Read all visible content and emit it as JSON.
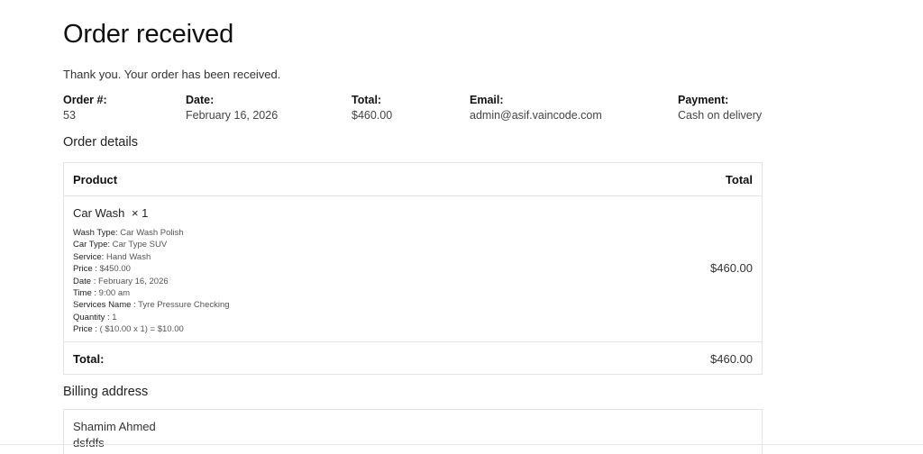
{
  "page": {
    "title": "Order received",
    "thank_you": "Thank you. Your order has been received."
  },
  "overview": {
    "order_number_label": "Order #:",
    "order_number": "53",
    "date_label": "Date:",
    "date": "February 16, 2026",
    "total_label": "Total:",
    "total": "$460.00",
    "email_label": "Email:",
    "email": "admin@asif.vaincode.com",
    "payment_label": "Payment:",
    "payment": "Cash on delivery"
  },
  "order_details": {
    "heading": "Order details",
    "columns": {
      "product": "Product",
      "total": "Total"
    },
    "items": [
      {
        "name": "Car Wash",
        "quantity": "× 1",
        "line_total": "$460.00",
        "meta": [
          {
            "key": "Wash Type:",
            "value": " Car Wash Polish"
          },
          {
            "key": "Car Type:",
            "value": " Car Type SUV"
          },
          {
            "key": "Service:",
            "value": " Hand Wash"
          },
          {
            "key": "Price :",
            "value": " $450.00"
          },
          {
            "key": "Date :",
            "value": " February 16, 2026"
          },
          {
            "key": "Time :",
            "value": " 9:00 am"
          },
          {
            "key": "Services Name :",
            "value": " Tyre Pressure Checking"
          },
          {
            "key": "Quantity :",
            "value": " 1"
          },
          {
            "key": "Price :",
            "value": " ( $10.00 x 1) = $10.00"
          }
        ]
      }
    ],
    "footer": {
      "total_label": "Total:",
      "total_value": "$460.00"
    }
  },
  "billing": {
    "heading": "Billing address",
    "name": "Shamim Ahmed",
    "address_line": "dsfdfs"
  }
}
